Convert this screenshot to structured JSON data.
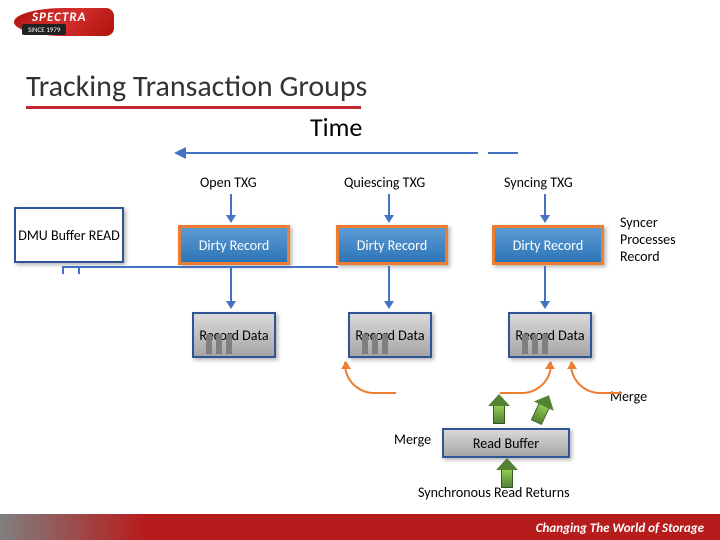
{
  "logo": {
    "brand": "SPECTRA",
    "since": "SINCE 1979"
  },
  "title": "Tracking Transaction Groups",
  "time_label": "Time",
  "columns": {
    "open": "Open TXG",
    "quiescing": "Quiescing TXG",
    "syncing": "Syncing TXG"
  },
  "dmu": "DMU Buffer READ",
  "dirty": "Dirty Record",
  "record_data": "Record Data",
  "syncer": "Syncer Processes Record",
  "merge": "Merge",
  "read_buffer": "Read Buffer",
  "sync_read": "Synchronous Read Returns",
  "tagline": "Changing The World of Storage"
}
